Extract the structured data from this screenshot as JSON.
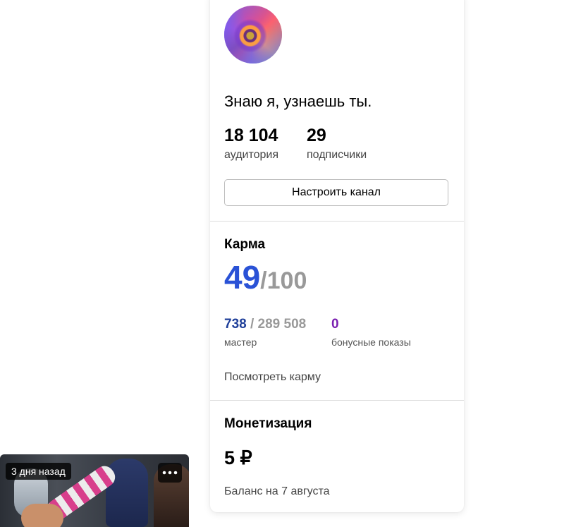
{
  "channel": {
    "title": "Знаю я, узнаешь ты.",
    "stats": [
      {
        "value": "18 104",
        "label": "аудитория"
      },
      {
        "value": "29",
        "label": "подписчики"
      }
    ],
    "setup_button_label": "Настроить канал"
  },
  "karma": {
    "title": "Карма",
    "score": "49",
    "max": "100",
    "master_value": "738",
    "master_total": "289 508",
    "master_label": "мастер",
    "bonus_value": "0",
    "bonus_label": "бонусные показы",
    "view_link": "Посмотреть карму",
    "colors": {
      "score": "#2a52d6",
      "master": "#1f3f9a",
      "bonus": "#7a1fb0"
    }
  },
  "monetization": {
    "title": "Монетизация",
    "balance": "5 ₽",
    "balance_date": "Баланс на 7 августа"
  },
  "video_card": {
    "time_badge": "3 дня назад",
    "more_icon": "more-dots-icon"
  }
}
